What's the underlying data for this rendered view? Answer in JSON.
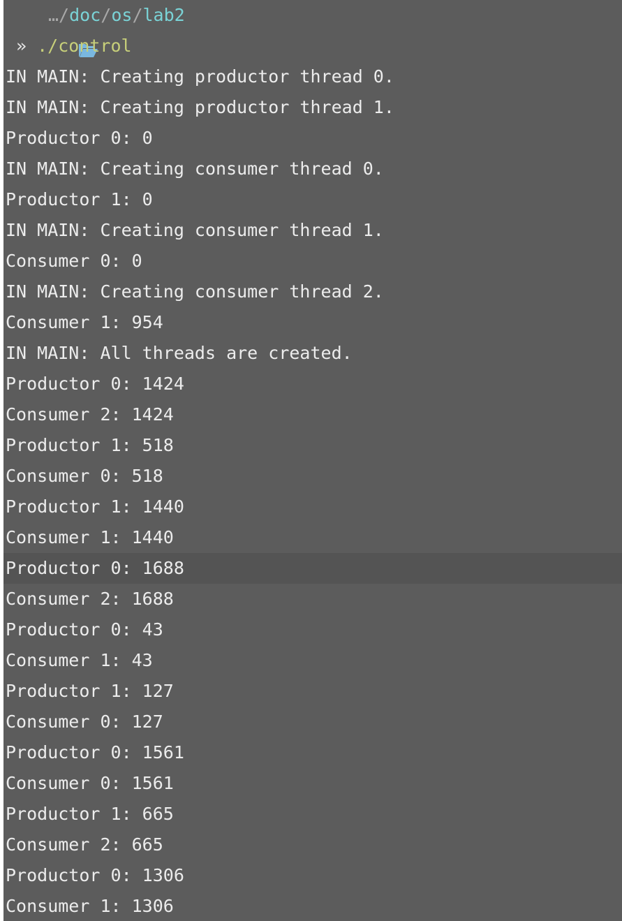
{
  "prompt": {
    "ellipsis": "…/",
    "path_segments": [
      "doc",
      "os",
      "lab2"
    ],
    "separator": "/",
    "arrow": "»",
    "command": "./control",
    "status_colors": {
      "check": "#a6c24a",
      "chevron": "#8a8a8a"
    }
  },
  "output_lines": [
    "IN MAIN: Creating productor thread 0.",
    "IN MAIN: Creating productor thread 1.",
    "Productor 0: 0",
    "IN MAIN: Creating consumer thread 0.",
    "Productor 1: 0",
    "IN MAIN: Creating consumer thread 1.",
    "Consumer 0: 0",
    "IN MAIN: Creating consumer thread 2.",
    "Consumer 1: 954",
    "IN MAIN: All threads are created.",
    "Productor 0: 1424",
    "Consumer 2: 1424",
    "Productor 1: 518",
    "Consumer 0: 518",
    "Productor 1: 1440",
    "Consumer 1: 1440",
    "Productor 0: 1688",
    "Consumer 2: 1688",
    "Productor 0: 43",
    "Consumer 1: 43",
    "Productor 1: 127",
    "Consumer 0: 127",
    "Productor 0: 1561",
    "Consumer 0: 1561",
    "Productor 1: 665",
    "Consumer 2: 665",
    "Productor 0: 1306",
    "Consumer 1: 1306"
  ]
}
